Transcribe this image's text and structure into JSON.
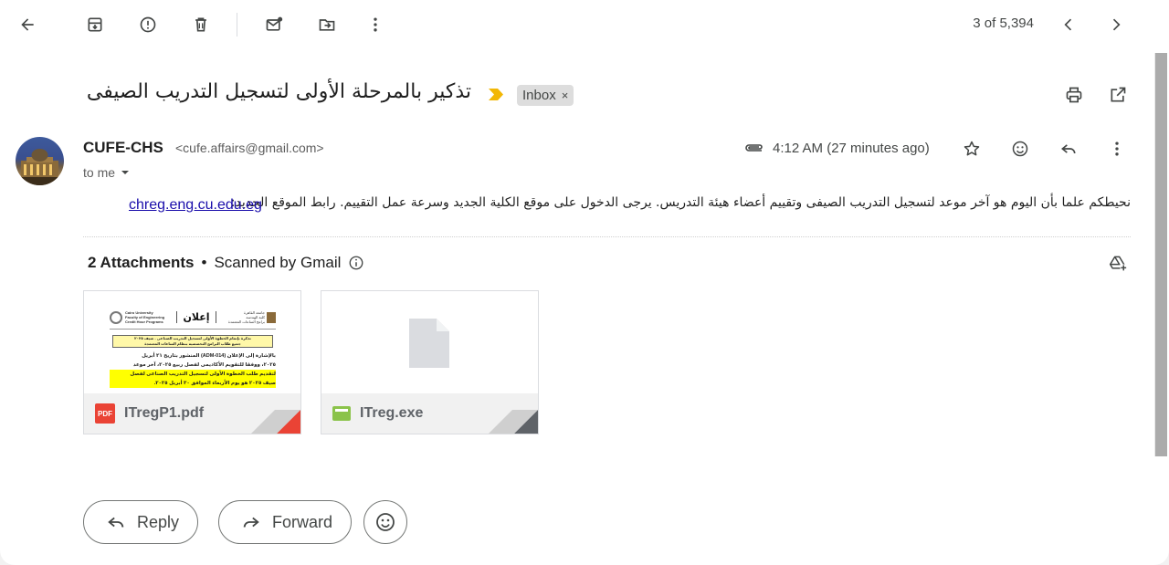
{
  "toolbar": {
    "back": "back-arrow-icon",
    "archive": "archive-icon",
    "report_spam": "report-spam-icon",
    "delete": "trash-icon",
    "mark_unread": "mark-unread-icon",
    "move_to": "move-to-icon",
    "more": "more-vert-icon",
    "counter": "3 of 5,394"
  },
  "email": {
    "subject": "تذكير بالمرحلة الأولى لتسجيل التدريب الصيفى",
    "label_chip": "Inbox",
    "label_remove": "×",
    "sender_name": "CUFE-CHS",
    "sender_email": "<cufe.affairs@gmail.com>",
    "recipient": "to me",
    "time": "4:12 AM (27 minutes ago)",
    "body": "نحيطكم علما بأن اليوم هو آخر موعد لتسجيل التدريب الصيفى وتقييم أعضاء هيئة التدريس. يرجى الدخول على موقع الكلية الجديد وسرعة عمل التقييم. رابط الموقع الجديد:",
    "body_link": "chreg.eng.cu.edu.eg"
  },
  "attachments": {
    "count_label": "2 Attachments",
    "separator": "•",
    "scanned_label": "Scanned by Gmail",
    "items": [
      {
        "name": "ITregP1.pdf",
        "badge": "PDF",
        "type": "pdf",
        "fold_color": "#ea4335",
        "preview": {
          "university_en": "Cairo University",
          "faculty_en": "Faculty of Engineering",
          "programs_en": "Credit Hour Programs",
          "title_ar": "إعلان",
          "header_ar": "جامعة القاهرة",
          "header_ar_2": "كلية الهندسة",
          "header_ar_3": "برامج الساعات المعتمدة",
          "banner_line_1": "تذكرة بإتمام الخطوة الأولى لتسجيل التدريب الصناعى - صيف ٢٠٢٥",
          "banner_line_2": "جميع طلاب البرامج التخصصية بنظام الساعات المعتمدة",
          "line_1": "بالإشارة إلى الإعلان (ADM-014) المنشور بتاريخ ٢١ أبريل",
          "line_2": "٢٠٢٥، ووفقا للتقويم الأكاديمى لفصل ربيع ٢٠٢٥، آخر موعد",
          "line_3": "لتقديم طلب الخطوة الأولى لتسجيل التدريب الصناعى لفصل",
          "line_4": "صيف ٢٠٢٥ هو يوم الأربعاء الموافق ٣٠ أبريل ٢٠٢٥."
        }
      },
      {
        "name": "ITreg.exe",
        "type": "exe",
        "fold_color": "#5f6368"
      }
    ]
  },
  "actions": {
    "reply": "Reply",
    "forward": "Forward"
  },
  "colors": {
    "importance_marker": "#f2b705",
    "link": "#1a0dab",
    "pdf_red": "#ea4335",
    "exe_green": "#8bc34a"
  }
}
